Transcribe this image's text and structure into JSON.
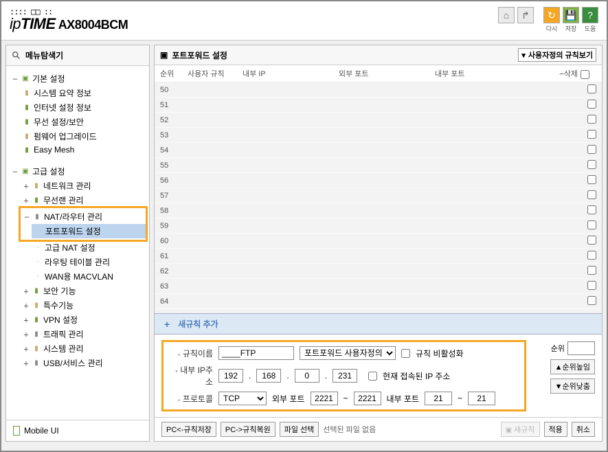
{
  "header": {
    "dots": ":::: □□ ::",
    "logo_ip": "ip",
    "logo_time": "TIME",
    "model": "AX8004BCM",
    "icons": {
      "home": "⌂",
      "exit": "↱",
      "refresh": "↻",
      "save": "💾",
      "help": "?",
      "refresh_label": "다시",
      "save_label": "저장",
      "help_label": "도움"
    }
  },
  "sidebar": {
    "title": "메뉴탐색기",
    "basic": {
      "label": "기본 설정",
      "items": [
        "시스템 요약 정보",
        "인터넷 설정 정보",
        "무선 설정/보안",
        "펌웨어 업그레이드",
        "Easy Mesh"
      ]
    },
    "advanced": {
      "label": "고급 설정",
      "items": [
        "네트워크 관리",
        "무선랜 관리"
      ],
      "nat": {
        "label": "NAT/라우터 관리",
        "children": [
          "포트포워드 설정",
          "고급 NAT 설정",
          "라우팅 테이블 관리",
          "WAN용 MACVLAN"
        ]
      },
      "rest": [
        "보안 기능",
        "특수기능",
        "VPN 설정",
        "트래픽 관리",
        "시스템 관리",
        "USB/서비스 관리"
      ]
    },
    "mobile": "Mobile UI"
  },
  "content": {
    "title": "포트포워드 설정",
    "view_select": "사용자정의 규칙보기",
    "columns": {
      "rank": "순위",
      "rule": "사용자 규칙",
      "ip": "내부 IP",
      "ext": "외부 포트",
      "int": "내부 포트",
      "del": "삭제"
    },
    "rows": [
      50,
      51,
      52,
      53,
      54,
      55,
      56,
      57,
      58,
      59,
      60,
      61,
      62,
      63,
      64
    ],
    "add_label": "새규칙 추가",
    "form": {
      "rule_name_label": "규칙이름",
      "rule_name_value": "____FTP",
      "type_select": "포트포워드 사용자정의",
      "disable_label": "규칙 비활성화",
      "ip_label": "내부 IP주소",
      "ip": [
        "192",
        "168",
        "0",
        "231"
      ],
      "current_ip_label": "현재 접속된 IP 주소",
      "proto_label": "프로토콜",
      "proto_value": "TCP",
      "ext_port_label": "외부 포트",
      "ext_port": [
        "2221",
        "2221"
      ],
      "int_port_label": "내부 포트",
      "int_port": [
        "21",
        "21"
      ],
      "rank_label": "순위",
      "rank_up": "▲순위높임",
      "rank_down": "▼순위낮춤"
    },
    "bottom": {
      "save_pc": "PC<-규칙저장",
      "load_pc": "PC->규칙복원",
      "file_select": "파일 선택",
      "no_file": "선택된 파일 없음",
      "new_rule": "새규칙",
      "apply": "적용",
      "cancel": "취소"
    }
  }
}
